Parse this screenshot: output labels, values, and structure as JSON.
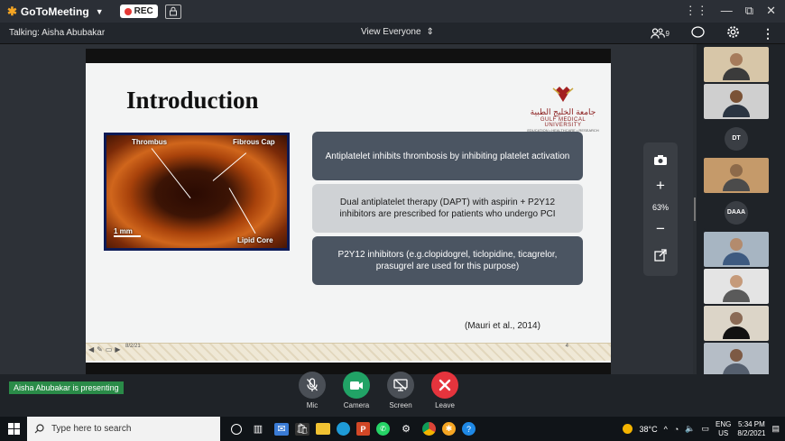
{
  "app": {
    "name": "GoToMeeting",
    "rec_label": "REC",
    "window_controls": [
      "⋮⋮",
      "—",
      "⧉",
      "✕"
    ]
  },
  "subbar": {
    "talking": "Talking: Aisha Abubakar",
    "view_label": "View Everyone",
    "attendee_count": "9"
  },
  "slide": {
    "title": "Introduction",
    "logo_arabic": "جامعة الخليج الطبية",
    "logo_english": "GULF MEDICAL UNIVERSITY",
    "logo_tagline": "EDUCATION • HEALTHCARE • RESEARCH",
    "image_labels": {
      "thrombus": "Thrombus",
      "fibrous_cap": "Fibrous Cap",
      "lipid_core": "Lipid Core",
      "scale": "1 mm"
    },
    "boxes": [
      "Antiplatelet inhibits thrombosis by inhibiting platelet activation",
      "Dual antiplatelet therapy (DAPT) with aspirin + P2Y12 inhibitors are prescribed for patients who undergo PCI",
      "P2Y12 inhibitors (e.g.clopidogrel, ticlopidine, ticagrelor, prasugrel are used for this purpose)"
    ],
    "citation": "(Mauri et al., 2014)",
    "footer_date": "8/2/21",
    "footer_page": "4"
  },
  "zoom": {
    "level": "63%"
  },
  "participants": [
    {
      "type": "video",
      "skin": "#a67b5b",
      "shirt": "#3b3b3b",
      "bg": "#d7c6a8"
    },
    {
      "type": "video",
      "skin": "#7a5236",
      "shirt": "#2b3542",
      "bg": "#cfcfcf"
    },
    {
      "type": "initials",
      "initials": "DT"
    },
    {
      "type": "video",
      "skin": "#8d6a4a",
      "shirt": "#4b4b4b",
      "bg": "#c59a6a"
    },
    {
      "type": "initials",
      "initials": "DAAA"
    },
    {
      "type": "video",
      "skin": "#b38b6d",
      "shirt": "#3d5a80",
      "bg": "#a7b5c2"
    },
    {
      "type": "video",
      "skin": "#c59a7a",
      "shirt": "#5a5a5a",
      "bg": "#e4e4e4"
    },
    {
      "type": "video",
      "skin": "#8a6a55",
      "shirt": "#111111",
      "bg": "#dcd5c8"
    },
    {
      "type": "video",
      "skin": "#7d5a44",
      "shirt": "#555f6e",
      "bg": "#b5bdc6"
    }
  ],
  "presenting": "Aisha Abubakar is presenting",
  "controls": {
    "mic": "Mic",
    "camera": "Camera",
    "screen": "Screen",
    "leave": "Leave"
  },
  "colors": {
    "camera_green": "#21a366",
    "leave_red": "#e5343d",
    "neutral_btn": "#4a4f56"
  },
  "taskbar": {
    "search_placeholder": "Type here to search",
    "weather": "38°C",
    "lang_top": "ENG",
    "lang_bottom": "US",
    "time": "5:34 PM",
    "date": "8/2/2021"
  }
}
